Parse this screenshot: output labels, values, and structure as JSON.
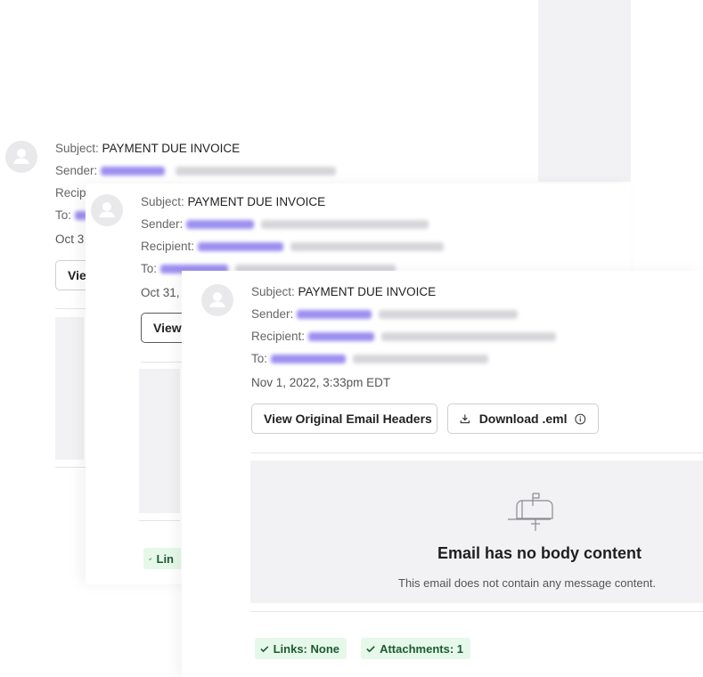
{
  "emails": [
    {
      "subject_label": "Subject:",
      "subject": "PAYMENT DUE INVOICE",
      "sender_label": "Sender:",
      "recipient_label": "Recip",
      "to_label": "To:",
      "date": "Oct 3",
      "view_button": "Vie"
    },
    {
      "subject_label": "Subject:",
      "subject": "PAYMENT DUE INVOICE",
      "sender_label": "Sender:",
      "recipient_label": "Recipient:",
      "to_label": "To:",
      "date": "Oct 31,",
      "view_button": "View",
      "chip_links": "Lin"
    },
    {
      "subject_label": "Subject:",
      "subject": "PAYMENT DUE INVOICE",
      "sender_label": "Sender:",
      "recipient_label": "Recipient:",
      "to_label": "To:",
      "date": "Nov 1, 2022, 3:33pm EDT",
      "view_button": "View Original Email Headers",
      "download_button": "Download .eml",
      "empty_title": "Email has no body content",
      "empty_subtitle": "This email does not contain any message content.",
      "chip_links": "Links: None",
      "chip_attachments": "Attachments: 1"
    }
  ],
  "icons": {
    "avatar": "user-avatar-icon",
    "download": "download-icon",
    "info": "info-icon",
    "mailbox": "mailbox-icon",
    "check": "check-icon"
  },
  "colors": {
    "chip_bg": "#e5f8e9",
    "chip_text": "#1f5a33",
    "redaction": "#9c8ef0",
    "body_bg": "#f2f2f4"
  }
}
